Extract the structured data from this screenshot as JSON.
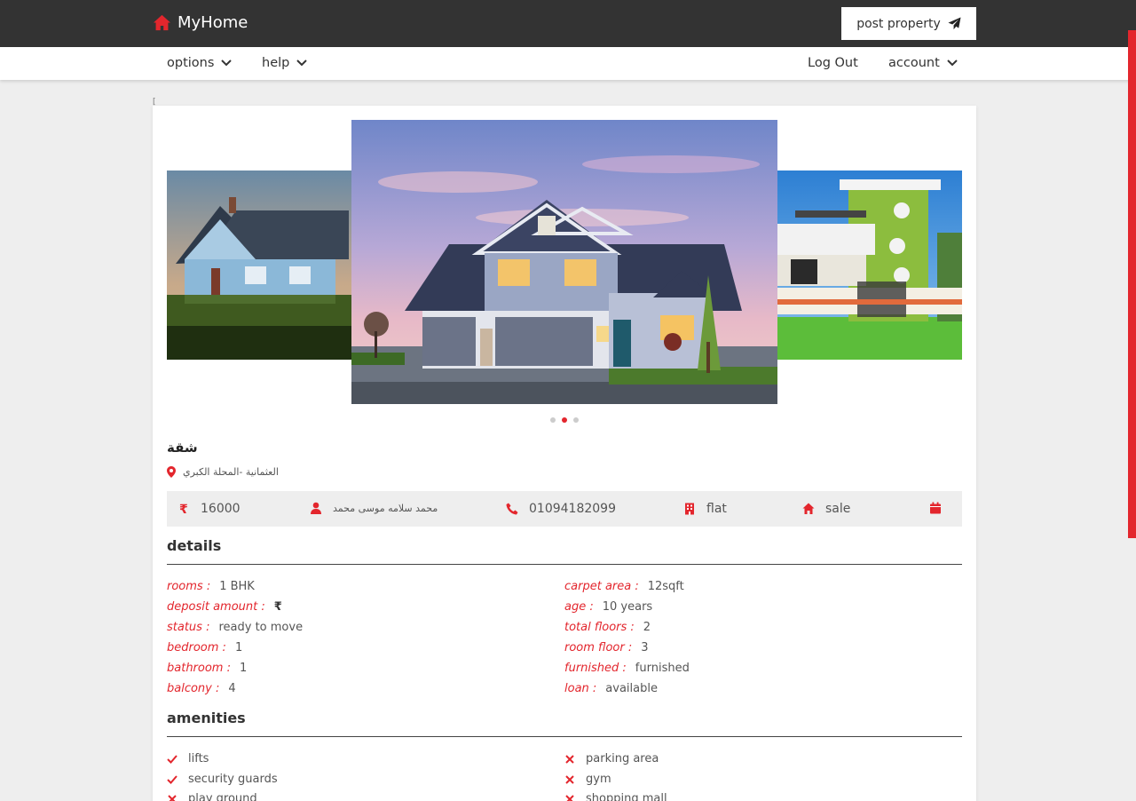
{
  "header": {
    "brand": "MyHome",
    "post_button": "post property"
  },
  "nav": {
    "options": "options",
    "help": "help",
    "logout": "Log Out",
    "account": "account"
  },
  "stray_mark": "[",
  "carousel": {
    "slides": [
      "house-blue-cottage",
      "house-modern-garage",
      "house-green-facade"
    ],
    "active_index": 1
  },
  "property": {
    "title": "شقة",
    "location": "العثمانية -المحلة الكبري",
    "price": "16000",
    "owner": "محمد سلامه موسى محمد",
    "phone": "01094182099",
    "type": "flat",
    "listing": "sale"
  },
  "details": {
    "title": "details",
    "left": [
      {
        "label": "rooms :",
        "value": "1 BHK"
      },
      {
        "label": "deposit amount :",
        "value": "₹"
      },
      {
        "label": "status :",
        "value": "ready to move"
      },
      {
        "label": "bedroom :",
        "value": "1"
      },
      {
        "label": "bathroom :",
        "value": "1"
      },
      {
        "label": "balcony :",
        "value": "4"
      }
    ],
    "right": [
      {
        "label": "carpet area :",
        "value": "12sqft"
      },
      {
        "label": "age :",
        "value": "10 years"
      },
      {
        "label": "total floors :",
        "value": "2"
      },
      {
        "label": "room floor :",
        "value": "3"
      },
      {
        "label": "furnished :",
        "value": "furnished"
      },
      {
        "label": "loan :",
        "value": "available"
      }
    ]
  },
  "amenities": {
    "title": "amenities",
    "left": [
      {
        "name": "lifts",
        "available": true
      },
      {
        "name": "security guards",
        "available": true
      },
      {
        "name": "play ground",
        "available": false
      }
    ],
    "right": [
      {
        "name": "parking area",
        "available": false
      },
      {
        "name": "gym",
        "available": false
      },
      {
        "name": "shopping mall",
        "available": false
      }
    ]
  },
  "colors": {
    "accent": "#e3262d",
    "header_bg": "#333333",
    "page_bg": "#eeeeee"
  }
}
